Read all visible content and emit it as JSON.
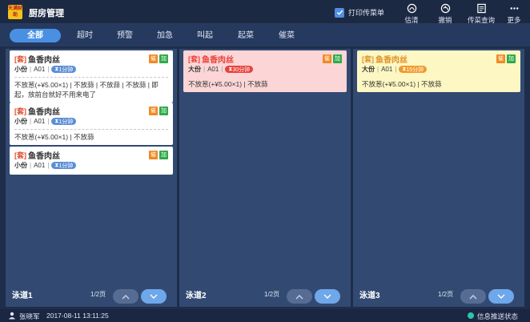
{
  "app": {
    "logo_text": "天满财助",
    "title": "厨房管理"
  },
  "toolbar": {
    "print_label": "打印传菜单",
    "print_checked": true,
    "tools": [
      {
        "label": "估清",
        "icon": "clear-stock-icon"
      },
      {
        "label": "撤销",
        "icon": "undo-icon"
      },
      {
        "label": "传菜查询",
        "icon": "query-icon"
      },
      {
        "label": "更多",
        "icon": "more-icon"
      }
    ]
  },
  "filters": [
    "全部",
    "超时",
    "预警",
    "加急",
    "叫起",
    "起菜",
    "催菜"
  ],
  "active_filter": "全部",
  "columns": [
    {
      "name": "泳道1",
      "page": "1/2页",
      "cards": [
        {
          "set_tag": "[套]",
          "dish": "鱼香肉丝",
          "badges": [
            "催",
            "加"
          ],
          "size": "小份",
          "table": "A01",
          "timer": "1分钟",
          "notes": "不放葱(+¥5.00×1) | 不放蒜 | 不放蒜 | 不放蒜 | 即起，放前台就好不用来电了",
          "style": "white"
        },
        {
          "set_tag": "[套]",
          "dish": "鱼香肉丝",
          "badges": [
            "催",
            "加"
          ],
          "size": "小份",
          "table": "A01",
          "timer": "1分钟",
          "notes": "不放葱(+¥5.00×1) | 不放蒜",
          "style": "white"
        },
        {
          "set_tag": "[套]",
          "dish": "鱼香肉丝",
          "badges": [
            "催",
            "加"
          ],
          "size": "小份",
          "table": "A01",
          "timer": "1分钟",
          "notes": "",
          "style": "white"
        }
      ]
    },
    {
      "name": "泳道2",
      "page": "1/2页",
      "cards": [
        {
          "set_tag": "[套]",
          "dish": "鱼香肉丝",
          "badges": [
            "催",
            "加"
          ],
          "size": "大份",
          "table": "A01",
          "timer": "30分钟",
          "notes": "不放葱(+¥5.00×1) | 不放蒜",
          "style": "pink"
        }
      ]
    },
    {
      "name": "泳道3",
      "page": "1/2页",
      "cards": [
        {
          "set_tag": "[套]",
          "dish": "鱼香肉丝",
          "badges": [
            "催",
            "加"
          ],
          "size": "大份",
          "table": "A01",
          "timer": "15分钟",
          "notes": "不放葱(+¥5.00×1) | 不放蒜",
          "style": "yellow"
        }
      ]
    }
  ],
  "status": {
    "user": "张晓军",
    "datetime": "2017-08-11 13:11:25",
    "push_status": "信息推送状态"
  },
  "colors": {
    "accent": "#4a90e2",
    "urgent": "#e8423a",
    "warning": "#f09a2a",
    "normal_timer": "#5b8fd6"
  }
}
